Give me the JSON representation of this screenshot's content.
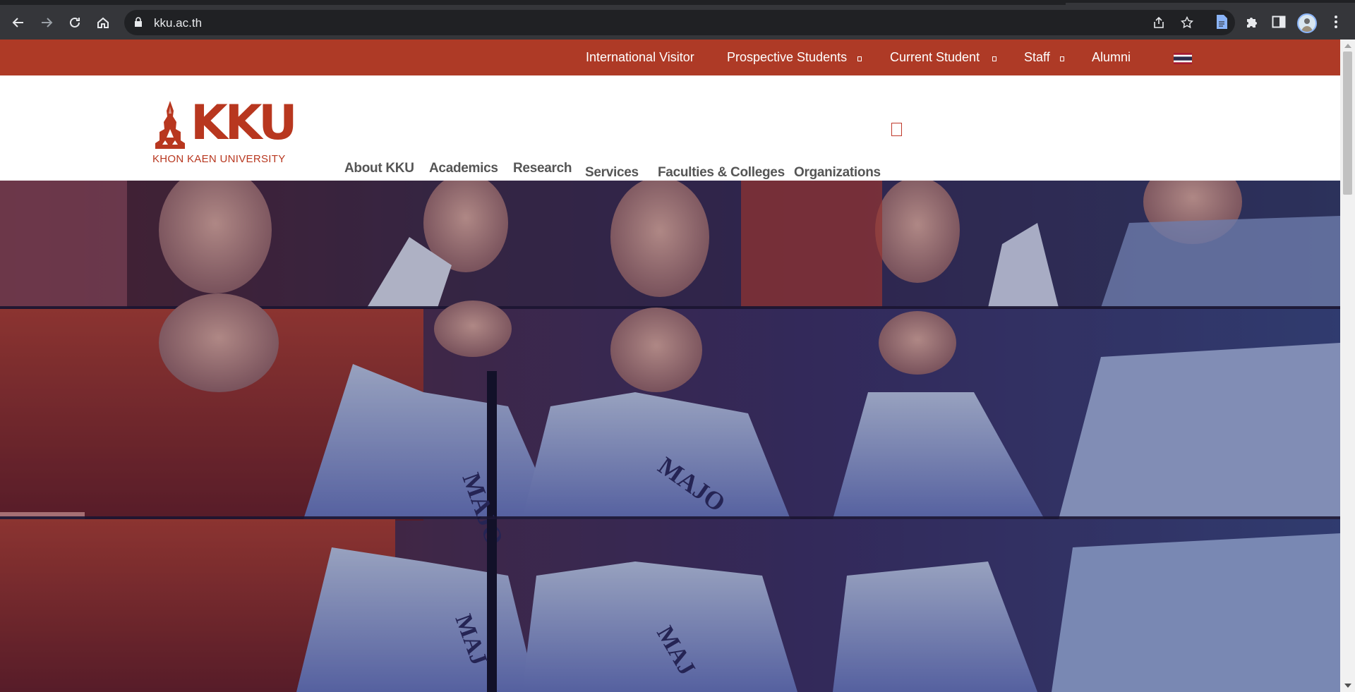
{
  "browser": {
    "url": "kku.ac.th",
    "icons": {
      "back": "back-arrow-icon",
      "forward": "forward-arrow-icon",
      "reload": "reload-icon",
      "home": "home-icon",
      "lock": "lock-icon",
      "share": "share-icon",
      "bookmark": "star-icon",
      "docs": "document-icon",
      "extensions": "puzzle-icon",
      "side_panel": "side-panel-icon",
      "menu": "more-vert-icon"
    }
  },
  "topbar": {
    "background": "#ae3a26",
    "items": [
      {
        "label": "International Visitor",
        "has_dropdown": false
      },
      {
        "label": "Prospective Students",
        "has_dropdown": true
      },
      {
        "label": "Current Student",
        "has_dropdown": true
      },
      {
        "label": "Staff",
        "has_dropdown": true
      },
      {
        "label": "Alumni",
        "has_dropdown": false
      }
    ],
    "language_flag": "thai-flag-icon"
  },
  "logo": {
    "mark": "KKU",
    "subtitle": "KHON KAEN UNIVERSITY",
    "color": "#b8371f"
  },
  "main_nav": {
    "items": [
      {
        "label": "About KKU"
      },
      {
        "label": "Academics"
      },
      {
        "label": "Research"
      },
      {
        "label": "Services"
      },
      {
        "label": "Faculties & Colleges"
      },
      {
        "label": "Organizations"
      }
    ],
    "search_icon": "search-toggle-icon"
  },
  "hero": {
    "type": "video-banner",
    "subject": "students waving"
  }
}
